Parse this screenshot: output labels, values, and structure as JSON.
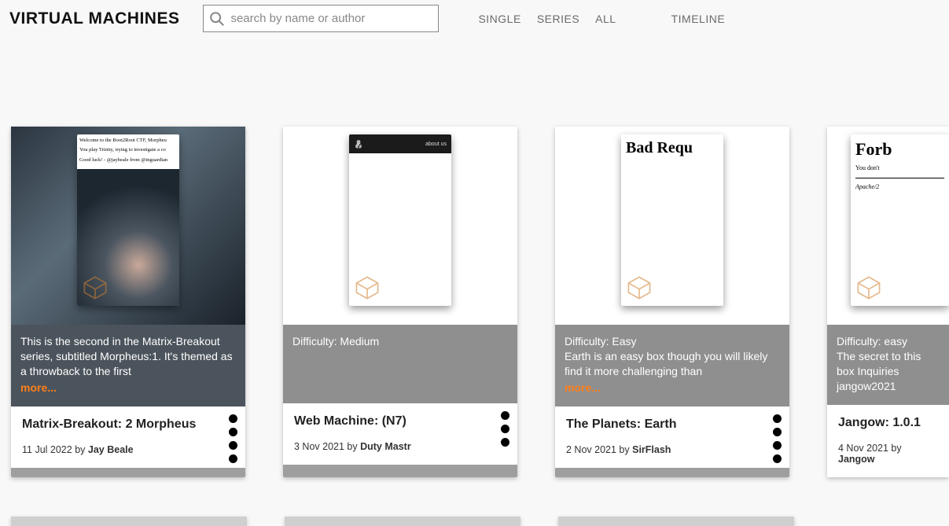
{
  "header": {
    "title": "VIRTUAL MACHINES",
    "search_placeholder": "search by name or author",
    "nav": {
      "single": "SINGLE",
      "series": "SERIES",
      "all": "ALL",
      "timeline": "TIMELINE"
    }
  },
  "cards": [
    {
      "inner": {
        "line1": "Welcome to the Boot2Root CTF, Morpheu",
        "line2": "You play Trinity, trying to investigate a co",
        "line3": "Good luck! - @jaybeale from @inguardian"
      },
      "description": "This is the second in the Matrix-Breakout series, subtitled Morpheus:1. It's themed as a throwback to the first",
      "more": "more...",
      "title": "Matrix-Breakout: 2 Morpheus",
      "date": "11 Jul 2022",
      "by": "by",
      "author": "Jay Beale",
      "dots": 4
    },
    {
      "inner": {
        "bar_text": "about us"
      },
      "difficulty_label": "Difficulty: Medium",
      "title": "Web Machine: (N7)",
      "date": "3 Nov 2021",
      "by": "by",
      "author": "Duty Mastr",
      "dots": 3
    },
    {
      "inner": {
        "heading": "Bad Requ"
      },
      "difficulty_label": "Difficulty: Easy",
      "description": "Earth is an easy box though you will likely find it more challenging than",
      "more": "more...",
      "title": "The Planets: Earth",
      "date": "2 Nov 2021",
      "by": "by",
      "author": "SirFlash",
      "dots": 4
    },
    {
      "inner": {
        "heading": "Forb",
        "sub": "You don't",
        "apache": "Apache/2"
      },
      "difficulty_label": "Difficulty: easy",
      "description": "The secret to this box Inquiries jangow2021",
      "title": "Jangow: 1.0.1",
      "date": "4 Nov 2021",
      "by": "by",
      "author": "Jangow",
      "dots": 0
    }
  ]
}
